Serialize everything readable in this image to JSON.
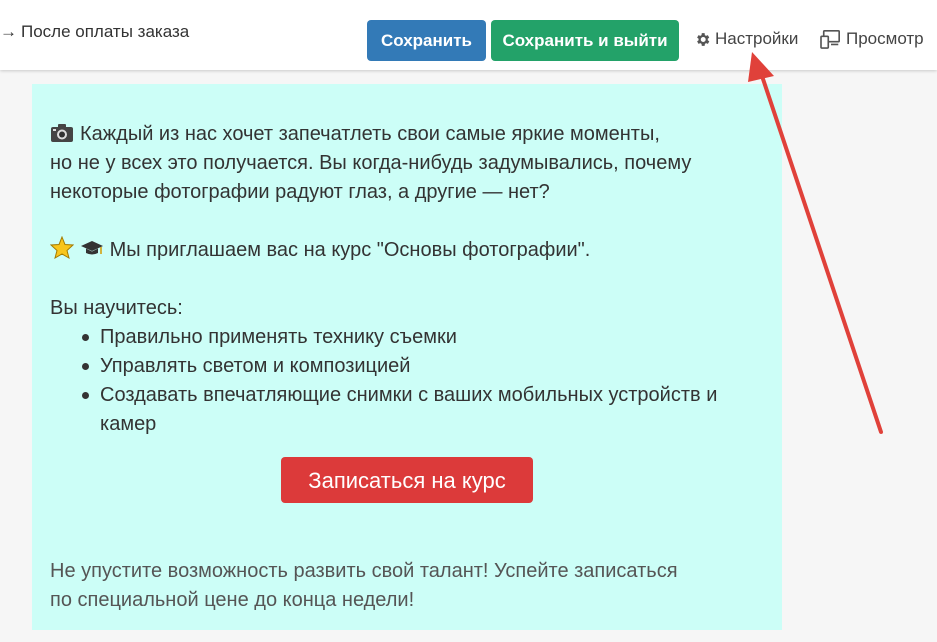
{
  "breadcrumb": {
    "arrow": "→",
    "label": "После оплаты заказа"
  },
  "toolbar": {
    "save_label": "Сохранить",
    "save_exit_label": "Сохранить и выйти",
    "settings_label": "Настройки",
    "preview_label": "Просмотр"
  },
  "content": {
    "intro_line1": "Каждый из нас хочет запечатлеть свои самые яркие моменты,",
    "intro_line2": "но не у всех это получается. Вы когда-нибудь задумывались, почему",
    "intro_line3": "некоторые фотографии радуют глаз, а другие — нет?",
    "invite": "Мы приглашаем вас на курс \"Основы фотографии\".",
    "learn_heading": "Вы научитесь:",
    "bullets": [
      "Правильно применять технику съемки",
      "Управлять светом и композицией",
      "Создавать впечатляющие снимки с ваших мобильных устройств и камер"
    ],
    "cta_label": "Записаться на курс",
    "closing_line1": "Не упустите возможность развить свой талант! Успейте записаться",
    "closing_line2": "по специальной цене до конца недели!"
  },
  "icons": {
    "camera": "camera-icon",
    "star": "star-icon",
    "graduation": "graduation-cap-icon",
    "gear": "gear-icon",
    "preview": "devices-icon"
  },
  "colors": {
    "save": "#337ab7",
    "save_exit": "#23a269",
    "cta": "#dc3a3a",
    "content_bg": "#ccfef7",
    "annotation_arrow": "#e0413a"
  }
}
